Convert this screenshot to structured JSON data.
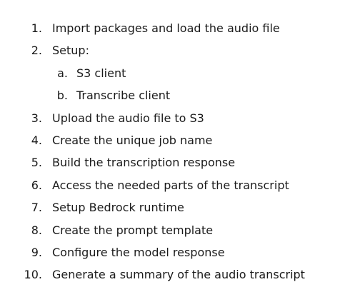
{
  "steps": [
    {
      "number": "1.",
      "text": "Import packages and load the audio file"
    },
    {
      "number": "2.",
      "text": "Setup:"
    },
    {
      "number": "a.",
      "text": "S3 client"
    },
    {
      "number": "b.",
      "text": "Transcribe client"
    },
    {
      "number": "3.",
      "text": "Upload the audio file to S3"
    },
    {
      "number": "4.",
      "text": "Create the unique job name"
    },
    {
      "number": "5.",
      "text": "Build the transcription response"
    },
    {
      "number": "6.",
      "text": "Access the needed parts of the transcript"
    },
    {
      "number": "7.",
      "text": "Setup Bedrock runtime"
    },
    {
      "number": "8.",
      "text": "Create the prompt template"
    },
    {
      "number": "9.",
      "text": "Configure the model response"
    },
    {
      "number": "10.",
      "text": "Generate a summary of the audio transcript"
    }
  ]
}
